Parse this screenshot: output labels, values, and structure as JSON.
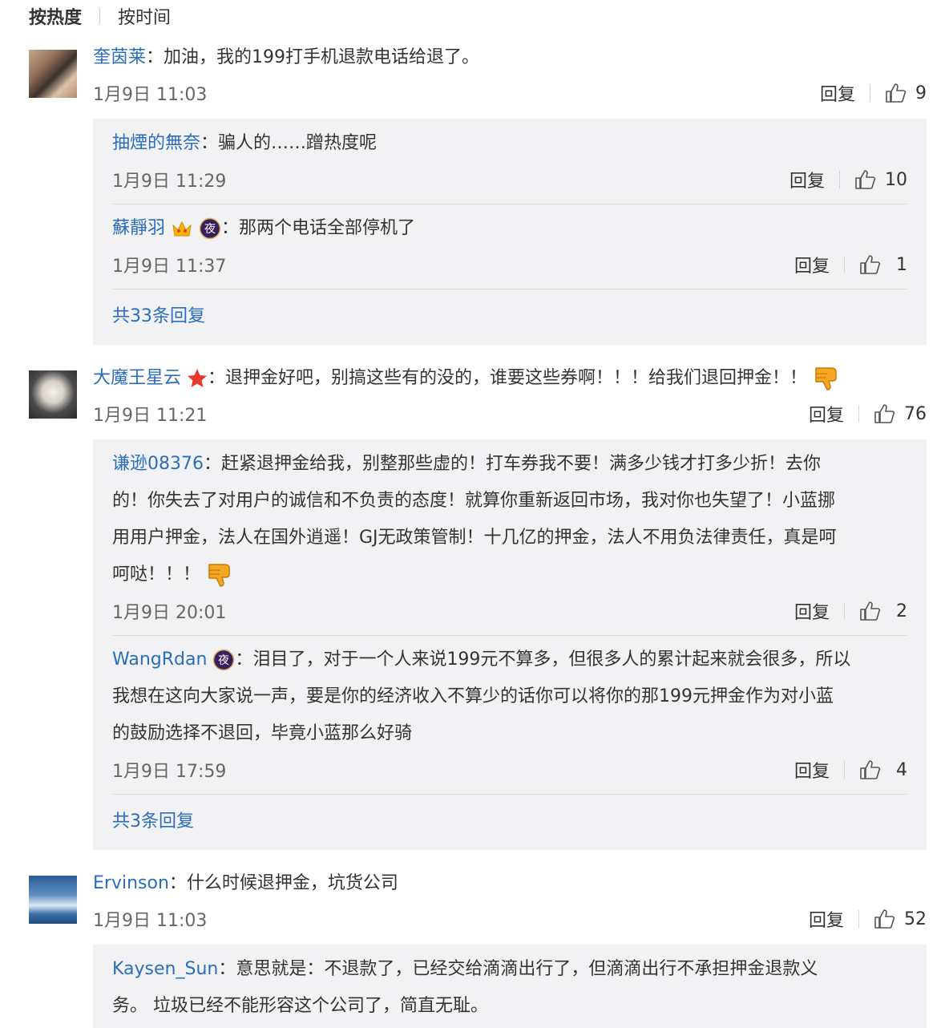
{
  "sort": {
    "hot": "按热度",
    "time": "按时间"
  },
  "comments": [
    {
      "user": "奎茵莱",
      "text": "加油，我的199打手机退款电话给退了。",
      "time": "1月9日 11:03",
      "reply": "回复",
      "likes": "9",
      "replies": [
        {
          "user": "抽煙的無奈",
          "text": "骗人的……蹭热度呢",
          "time": "1月9日 11:29",
          "reply": "回复",
          "likes": "10"
        },
        {
          "user": "蘇靜羽",
          "text": "那两个电话全部停机了",
          "time": "1月9日 11:37",
          "reply": "回复",
          "likes": "1"
        }
      ],
      "more": "共33条回复"
    },
    {
      "user": "大魔王星云",
      "text": "退押金好吧，别搞这些有的没的，谁要这些券啊！！！给我们退回押金！！",
      "time": "1月9日 11:21",
      "reply": "回复",
      "likes": "76",
      "replies": [
        {
          "user": "谦逊08376",
          "lines": [
            "赶紧退押金给我，别整那些虚的！打车券我不要！满多少钱才打多少折！去你",
            "的！你失去了对用户的诚信和不负责的态度！就算你重新返回市场，我对你也失望了！小蓝挪",
            "用用户押金，法人在国外逍遥！GJ无政策管制！十几亿的押金，法人不用负法律责任，真是呵",
            "呵哒！！！"
          ],
          "time": "1月9日 20:01",
          "reply": "回复",
          "likes": "2"
        },
        {
          "user": "WangRdan",
          "lines": [
            "泪目了，对于一个人来说199元不算多，但很多人的累计起来就会很多，所以",
            "我想在这向大家说一声，要是你的经济收入不算少的话你可以将你的那199元押金作为对小蓝",
            "的鼓励选择不退回，毕竟小蓝那么好骑"
          ],
          "time": "1月9日 17:59",
          "reply": "回复",
          "likes": "4"
        }
      ],
      "more": "共3条回复"
    },
    {
      "user": "Ervinson",
      "text": "什么时候退押金，坑货公司",
      "time": "1月9日 11:03",
      "reply": "回复",
      "likes": "52",
      "replies": [
        {
          "user": "Kaysen_Sun",
          "lines": [
            "意思就是：不退款了，已经交给滴滴出行了，但滴滴出行不承担押金退款义",
            "务。 垃圾已经不能形容这个公司了，简直无耻。"
          ]
        }
      ]
    }
  ],
  "badges": {
    "night": "夜"
  },
  "colors": {
    "link": "#2a6ebb",
    "reply_bg": "#f2f2f5",
    "emoji_orange": "#f5a623",
    "star_red": "#e8392c",
    "crown_gold": "#f7b500",
    "night_purple": "#5a2a86"
  },
  "icons": {
    "like": "thumbs-up-icon",
    "dislike": "thumbs-down-emoji-icon",
    "star": "red-star-icon",
    "crown": "crown-icon",
    "night": "night-badge-icon"
  }
}
